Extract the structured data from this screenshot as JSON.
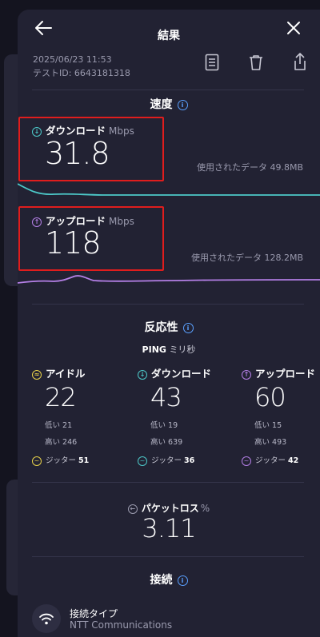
{
  "header": {
    "title": "結果"
  },
  "meta": {
    "datetime": "2025/06/23 11:53",
    "test_id": "テストID: 6643181318"
  },
  "speed": {
    "section_title": "速度",
    "download": {
      "label": "ダウンロード",
      "unit": "Mbps",
      "value": "31.8",
      "used": "使用されたデータ 49.8MB"
    },
    "upload": {
      "label": "アップロード",
      "unit": "Mbps",
      "value": "118",
      "used": "使用されたデータ 128.2MB"
    }
  },
  "responsiveness": {
    "section_title": "反応性",
    "ping_label": "PING",
    "ping_unit": "ミリ秒",
    "columns": [
      {
        "label": "アイドル",
        "value": "22",
        "low": "低い 21",
        "high": "高い 246",
        "jitter_label": "ジッター",
        "jitter": "51"
      },
      {
        "label": "ダウンロード",
        "value": "43",
        "low": "低い 19",
        "high": "高い 639",
        "jitter_label": "ジッター",
        "jitter": "36"
      },
      {
        "label": "アップロード",
        "value": "60",
        "low": "低い 15",
        "high": "高い 493",
        "jitter_label": "ジッター",
        "jitter": "42"
      }
    ],
    "packet_loss": {
      "label": "パケットロス",
      "unit": "%",
      "value": "3.11"
    }
  },
  "connection": {
    "section_title": "接続",
    "type_label": "接続タイプ",
    "provider": "NTT Communications"
  },
  "colors": {
    "download": "#4dc9c9",
    "upload": "#b47fe6",
    "idle": "#e8d24a",
    "info": "#5aa0ff",
    "highlight": "#e01d1d"
  }
}
